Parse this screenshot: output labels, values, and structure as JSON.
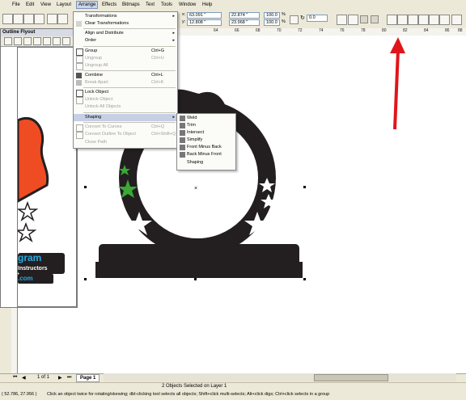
{
  "menubar": {
    "items": [
      "File",
      "Edit",
      "View",
      "Layout",
      "Arrange",
      "Effects",
      "Bitmaps",
      "Text",
      "Tools",
      "Window",
      "Help"
    ]
  },
  "toolbar": {
    "x_value": "63.091 \"",
    "y_value": "12.808 \"",
    "w_value": "22.874 \"",
    "h_value": "23.968 \"",
    "scale_x": "100.0",
    "scale_y": "100.0",
    "pct_symbol": "%",
    "rotation": "0.0"
  },
  "ruler": {
    "ticks": [
      "64",
      "66",
      "68",
      "70",
      "72",
      "74",
      "76",
      "78",
      "80",
      "82",
      "84",
      "86",
      "88"
    ]
  },
  "flyout": {
    "title": "Outline Flyout"
  },
  "arrange_menu": {
    "items": [
      {
        "label": "Transformations",
        "shortcut": "",
        "submenu": true,
        "disabled": false
      },
      {
        "label": "Clear Transformations",
        "shortcut": "",
        "submenu": false,
        "disabled": false
      },
      {
        "label": "Align and Distribute",
        "shortcut": "",
        "submenu": true,
        "disabled": false
      },
      {
        "label": "Order",
        "shortcut": "",
        "submenu": true,
        "disabled": false
      },
      {
        "label": "Group",
        "shortcut": "Ctrl+G",
        "submenu": false,
        "disabled": false
      },
      {
        "label": "Ungroup",
        "shortcut": "Ctrl+U",
        "submenu": false,
        "disabled": true
      },
      {
        "label": "Ungroup All",
        "shortcut": "",
        "submenu": false,
        "disabled": true
      },
      {
        "label": "Combine",
        "shortcut": "Ctrl+L",
        "submenu": false,
        "disabled": false
      },
      {
        "label": "Break Apart",
        "shortcut": "Ctrl+K",
        "submenu": false,
        "disabled": true
      },
      {
        "label": "Lock Object",
        "shortcut": "",
        "submenu": false,
        "disabled": false
      },
      {
        "label": "Unlock Object",
        "shortcut": "",
        "submenu": false,
        "disabled": true
      },
      {
        "label": "Unlock All Objects",
        "shortcut": "",
        "submenu": false,
        "disabled": true
      },
      {
        "label": "Shaping",
        "shortcut": "",
        "submenu": true,
        "disabled": false
      },
      {
        "label": "Convert To Curves",
        "shortcut": "Ctrl+Q",
        "submenu": false,
        "disabled": true
      },
      {
        "label": "Convert Outline To Object",
        "shortcut": "Ctrl+Shift+Q",
        "submenu": false,
        "disabled": true
      },
      {
        "label": "Close Path",
        "shortcut": "",
        "submenu": false,
        "disabled": true
      }
    ]
  },
  "shaping_menu": {
    "items": [
      "Weld",
      "Trim",
      "Intersect",
      "Simplify",
      "Front Minus Back",
      "Back Minus Front",
      "Shaping"
    ]
  },
  "artwork": {
    "left_text_1": "gram",
    "left_text_2": "Instructors",
    "left_text_3": ".com"
  },
  "pagebar": {
    "page_count": "1 of 1",
    "page_tab": "Page 1"
  },
  "status": {
    "selection": "2 Objects Selected on Layer 1",
    "coords": "( 52.786, 27.956 )",
    "hint": "Click an object twice for rotating/skewing; dbl-clicking tool selects all objects; Shift+click multi-selects; Alt+click digs; Ctrl+click selects in a group"
  },
  "colors": {
    "menu_bg": "#ece9d8",
    "highlight": "#c6cfe3",
    "art_dark": "#231f20",
    "star_green": "#3aa935",
    "annotation_arrow": "#e0151b",
    "logo_orange": "#ef4c23",
    "logo_blue": "#27a9e1"
  }
}
